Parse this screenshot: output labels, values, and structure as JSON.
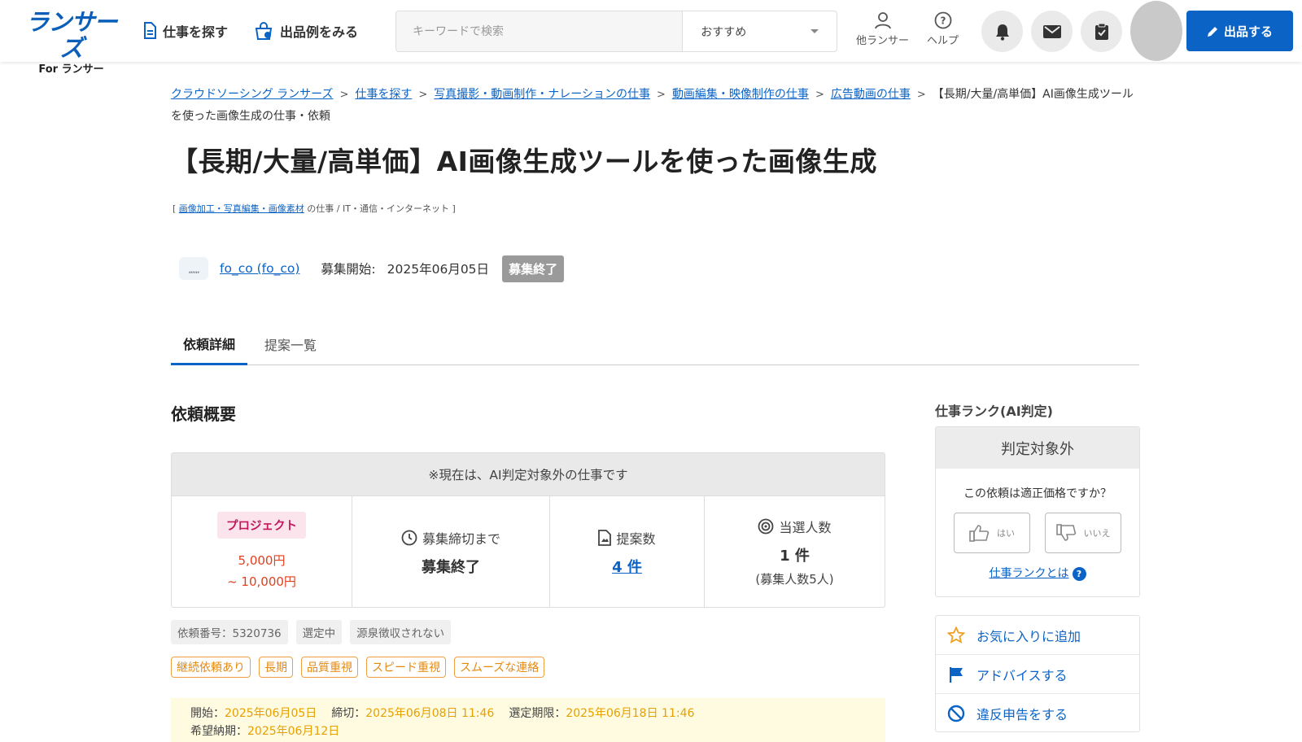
{
  "header": {
    "logo_main": "ランサーズ",
    "logo_sub": "For ランサー",
    "nav_find_jobs": "仕事を探す",
    "nav_examples": "出品例をみる",
    "search_placeholder": "キーワードで検索",
    "sort_selected": "おすすめ",
    "other_lancers": "他ランサー",
    "help": "ヘルプ",
    "post_button": "出品する",
    "brand_color": "#0b63c5"
  },
  "breadcrumb": {
    "items": [
      "クラウドソーシング ランサーズ",
      "仕事を探す",
      "写真撮影・動画制作・ナレーションの仕事",
      "動画編集・映像制作の仕事",
      "広告動画の仕事"
    ],
    "current": "【長期/大量/高単価】AI画像生成ツールを使った画像生成の仕事・依頼"
  },
  "job": {
    "title": "【長期/大量/高単価】AI画像生成ツールを使った画像生成",
    "category_link": "画像加工・写真編集・画像素材",
    "category_rest": " の仕事 / IT・通信・インターネット ]",
    "category_open": "[ ",
    "client_name": "fo_co (fo_co)",
    "start_label": "募集開始:",
    "start_date": "2025年06月05日",
    "status": "募集終了"
  },
  "tabs": [
    "依頼詳細",
    "提案一覧"
  ],
  "overview": {
    "heading": "依頼概要",
    "notice": "※現在は、AI判定対象外の仕事です",
    "type_tag": "プロジェクト",
    "price_min": "5,000円",
    "price_max": "~ 10,000円",
    "deadline_label": "募集締切まで",
    "deadline_value": "募集終了",
    "proposals_label": "提案数",
    "proposals_value": "4 件",
    "winners_label": "当選人数",
    "winners_value": "1 件",
    "winners_sub": "(募集人数5人)"
  },
  "chips": [
    "依頼番号：5320736",
    "選定中",
    "源泉徴収されない"
  ],
  "tags": [
    "継続依頼あり",
    "長期",
    "品質重視",
    "スピード重視",
    "スムーズな連絡"
  ],
  "dates": {
    "start_label": "開始：",
    "start": "2025年06月05日",
    "end_label": "締切：",
    "end": "2025年06月08日 11:46",
    "select_label": "選定期限：",
    "select": "2025年06月18日 11:46",
    "delivery_label": "希望納期：",
    "delivery": "2025年06月12日"
  },
  "sidebar": {
    "rank_heading": "仕事ランク(AI判定)",
    "rank_value": "判定対象外",
    "question": "この依頼は適正価格ですか？",
    "yes": "はい",
    "no": "いいえ",
    "rank_link": "仕事ランクとは",
    "actions": [
      "お気に入りに追加",
      "アドバイスする",
      "違反申告をする"
    ]
  }
}
